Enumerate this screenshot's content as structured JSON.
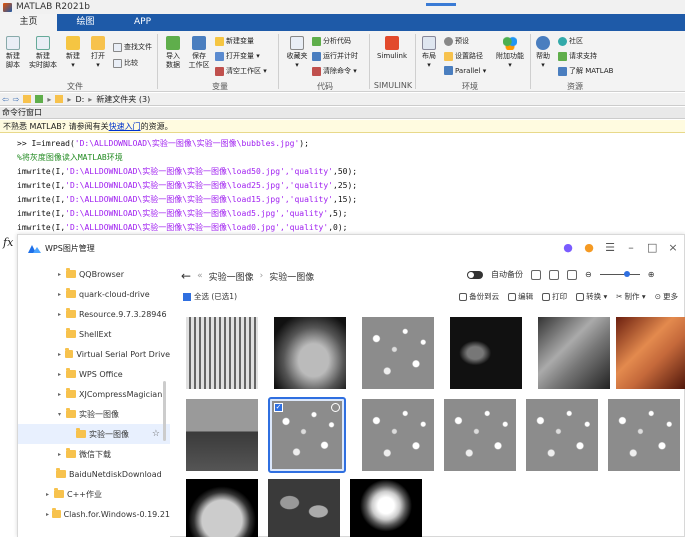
{
  "window": {
    "title": "MATLAB R2021b"
  },
  "tabs": [
    "主页",
    "绘图",
    "APP"
  ],
  "ribbon": {
    "file": {
      "new_script": "新建\n脚本",
      "new_live": "新建\n实时脚本",
      "new": "新建\n▾",
      "open": "打开\n▾",
      "find_files": "查找文件",
      "compare": "比较",
      "label": "文件"
    },
    "variable": {
      "import": "导入\n数据",
      "save_ws": "保存\n工作区",
      "new_var": "新建变量",
      "open_var": "打开变量 ▾",
      "clear_ws": "清空工作区 ▾",
      "label": "变量"
    },
    "code": {
      "favorites": "收藏夹\n▾",
      "analyze": "分析代码",
      "run_time": "运行并计时",
      "clear_cmd": "清除命令 ▾",
      "label": "代码"
    },
    "simulink": {
      "simulink": "Simulink",
      "label": "SIMULINK"
    },
    "env": {
      "layout": "布局\n▾",
      "prefs": "预设",
      "set_path": "设置路径",
      "parallel": "Parallel ▾",
      "addons": "附加功能\n▾",
      "label": "环境"
    },
    "resources": {
      "help": "帮助\n▾",
      "community": "社区",
      "request_support": "请求支持",
      "learn": "了解 MATLAB",
      "label": "资源"
    }
  },
  "address": {
    "path": [
      "D:",
      "新建文件夹 (3)"
    ]
  },
  "command_window": {
    "label": "命令行窗口",
    "notice_prefix": "不熟悉 MATLAB? 请参阅有关",
    "notice_link": "快速入门",
    "notice_suffix": "的资源。",
    "lines": [
      {
        "pre": ">> I=imread(",
        "str": "'D:\\ALLDOWNLOAD\\实验一图像\\实验一图像\\bubbles.jpg'",
        "post": ");"
      },
      {
        "comment": "%将灰度图像读入MATLAB环境"
      },
      {
        "pre": "imwrite(I,",
        "str": "'D:\\ALLDOWNLOAD\\实验一图像\\实验一图像\\load50.jpg','quality'",
        "post": ",50);"
      },
      {
        "pre": "imwrite(I,",
        "str": "'D:\\ALLDOWNLOAD\\实验一图像\\实验一图像\\load25.jpg','quality'",
        "post": ",25);"
      },
      {
        "pre": "imwrite(I,",
        "str": "'D:\\ALLDOWNLOAD\\实验一图像\\实验一图像\\load15.jpg','quality'",
        "post": ",15);"
      },
      {
        "pre": "imwrite(I,",
        "str": "'D:\\ALLDOWNLOAD\\实验一图像\\实验一图像\\load5.jpg','quality'",
        "post": ",5);"
      },
      {
        "pre": "imwrite(I,",
        "str": "'D:\\ALLDOWNLOAD\\实验一图像\\实验一图像\\load0.jpg','quality'",
        "post": ",0);"
      }
    ],
    "prompt_symbol": "fx"
  },
  "wps": {
    "title": "WPS图片管理",
    "tree": [
      {
        "label": "QQBrowser",
        "arrow": "▸"
      },
      {
        "label": "quark-cloud-drive",
        "arrow": "▸"
      },
      {
        "label": "Resource.9.7.3.28946",
        "arrow": "▸"
      },
      {
        "label": "ShellExt",
        "arrow": ""
      },
      {
        "label": "Virtual Serial Port Drive",
        "arrow": "▸"
      },
      {
        "label": "WPS Office",
        "arrow": "▸"
      },
      {
        "label": "XJCompressMagician",
        "arrow": "▸"
      },
      {
        "label": "实验一图像",
        "arrow": "▾"
      },
      {
        "label": "实验一图像",
        "arrow": ""
      },
      {
        "label": "微信下载",
        "arrow": "▸"
      },
      {
        "label": "BaiduNetdiskDownload",
        "arrow": ""
      },
      {
        "label": "C++作业",
        "arrow": "▸"
      },
      {
        "label": "Clash.for.Windows-0.19.21",
        "arrow": "▸"
      }
    ],
    "breadcrumb": [
      "实验一图像",
      "实验一图像"
    ],
    "auto_backup": "自动备份",
    "select_all": "全选 (已选1)",
    "actions": {
      "backup": "备份到云",
      "edit": "编辑",
      "print": "打印",
      "convert": "转换 ▾",
      "copy": "制作 ▾",
      "more": "更多"
    },
    "thumbs": [
      "circuit",
      "mammogram",
      "bubbles",
      "xray",
      "lena-gray",
      "lena-color",
      "cameraman",
      "bubbles",
      "bubbles",
      "bubbles",
      "bubbles",
      "bubbles",
      "moon",
      "beans",
      "rose"
    ]
  }
}
